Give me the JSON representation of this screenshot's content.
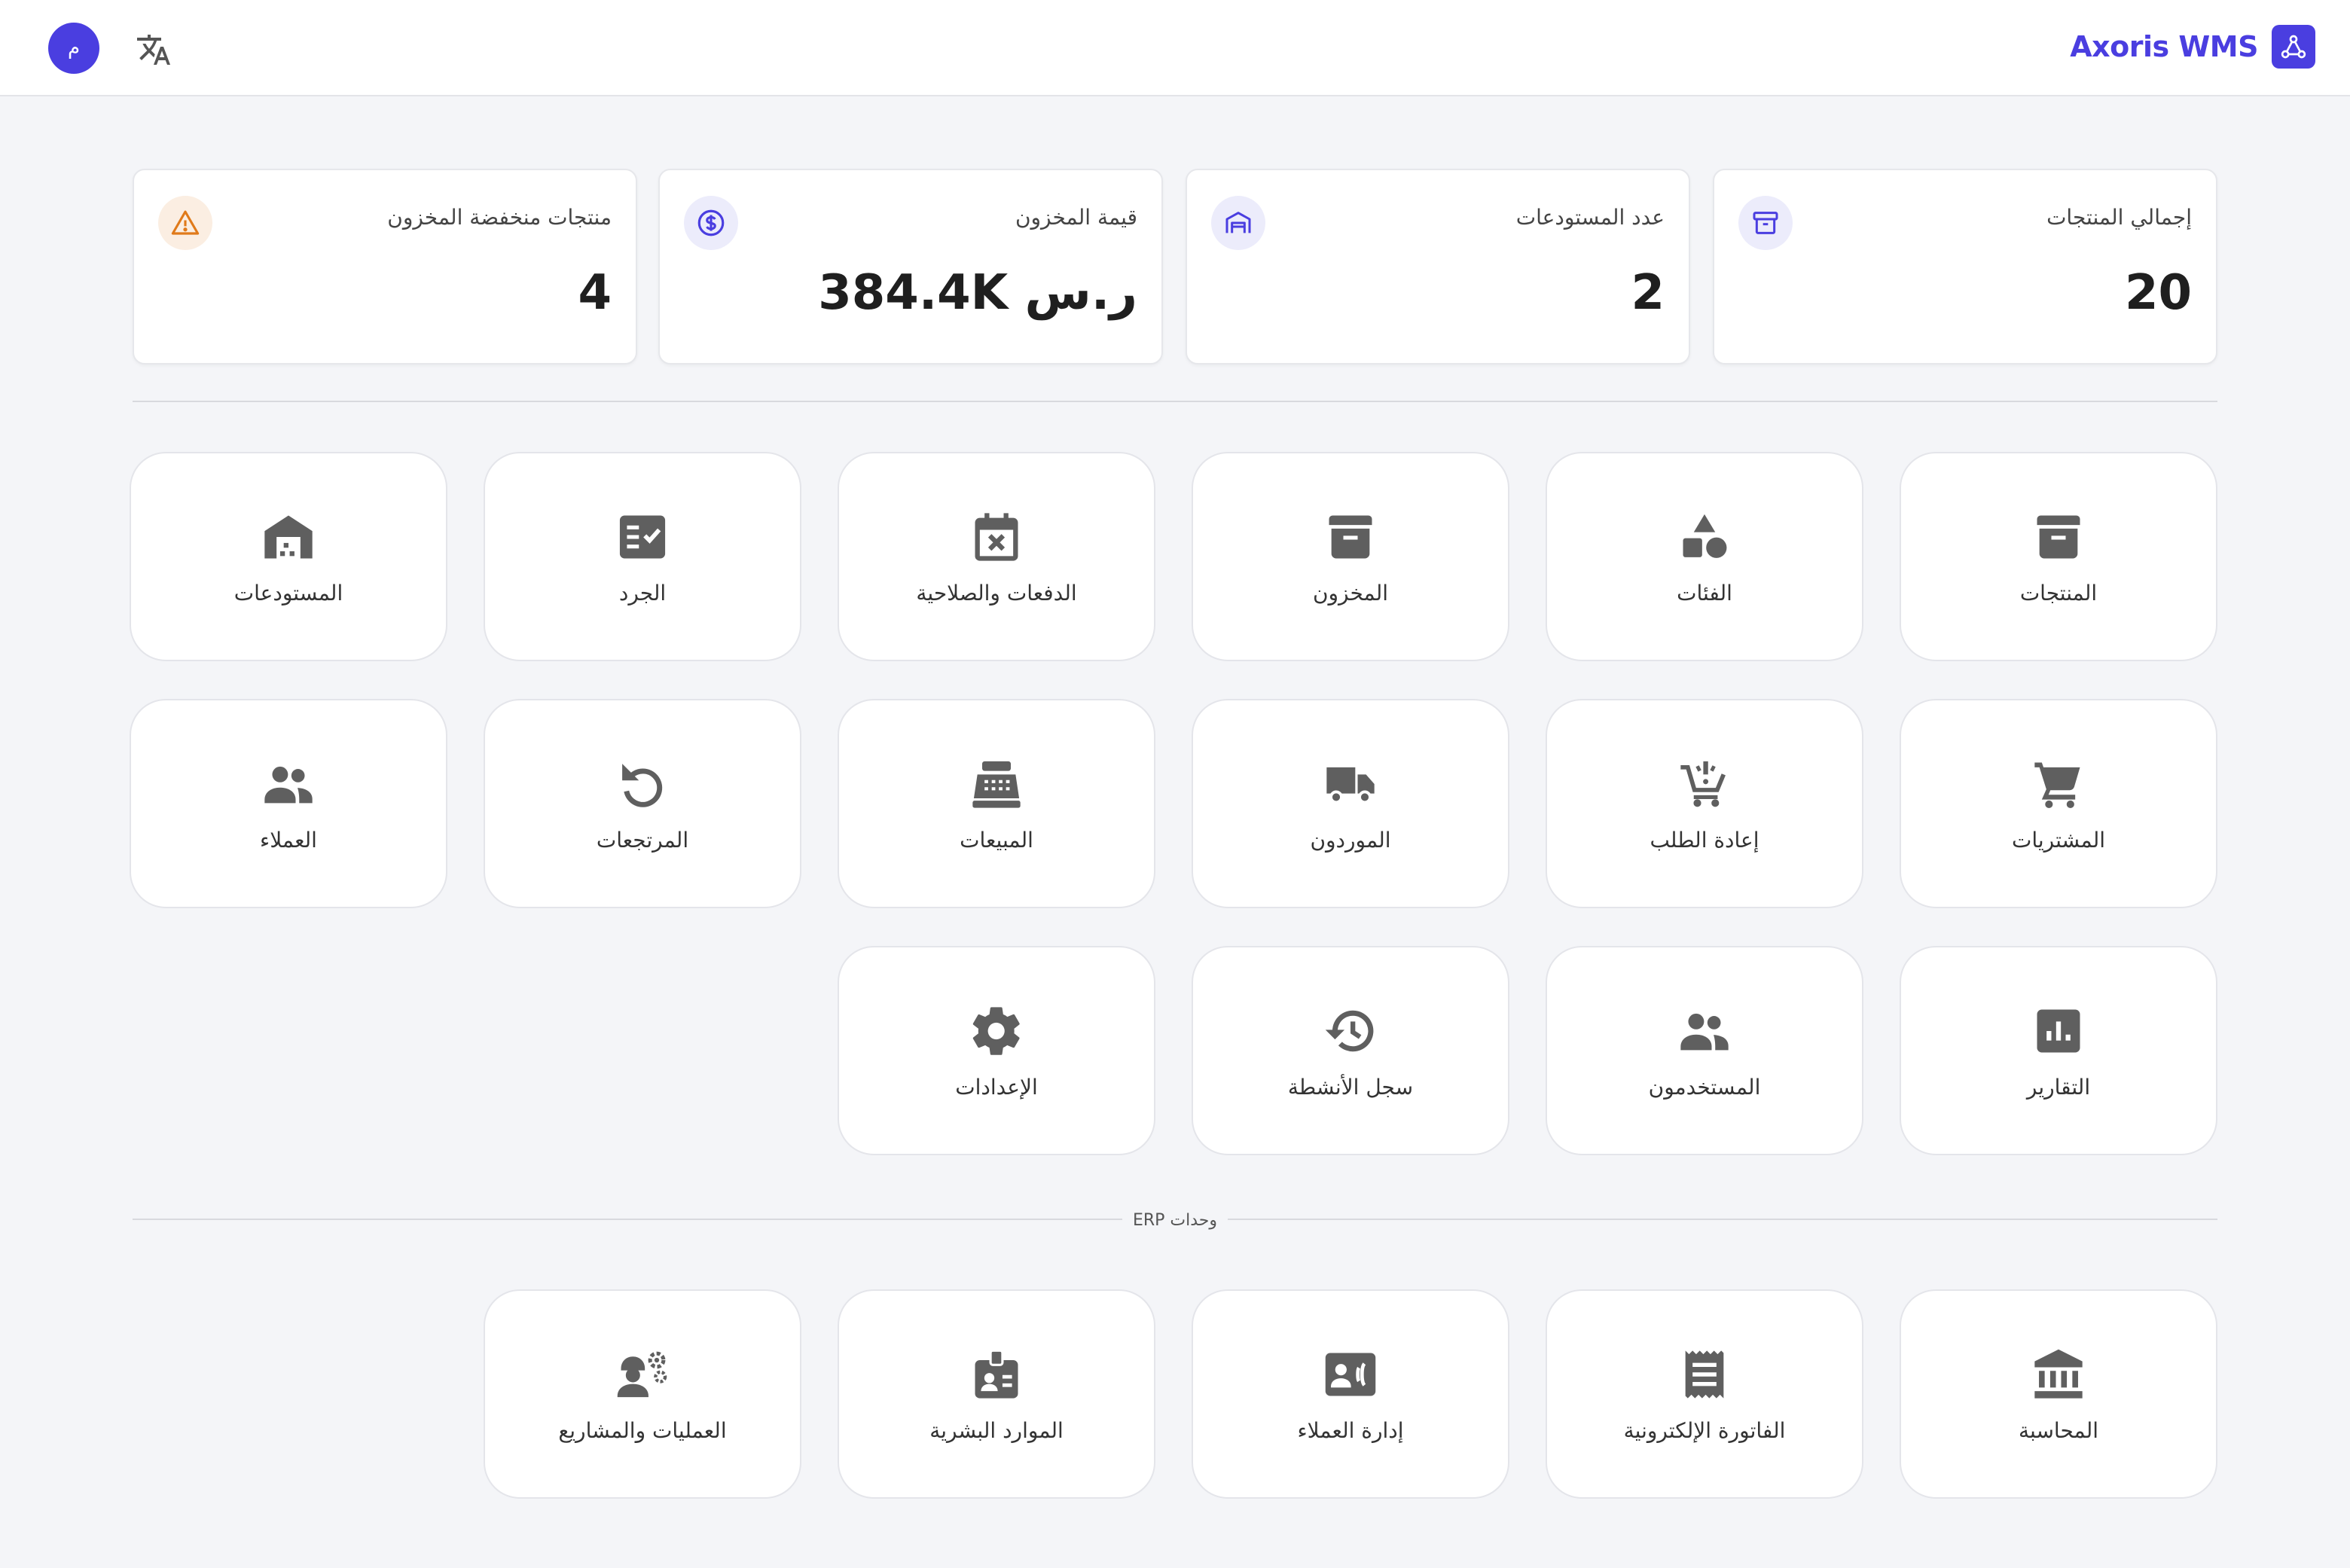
{
  "header": {
    "brand": "Axoris WMS",
    "avatar_initial": "م"
  },
  "stats": [
    {
      "label": "إجمالي المنتجات",
      "value": "20",
      "icon": "archive-icon",
      "color": "#4a3ee0"
    },
    {
      "label": "عدد المستودعات",
      "value": "2",
      "icon": "warehouse-icon",
      "color": "#4a3ee0"
    },
    {
      "label": "قيمة المخزون",
      "value": "384.4K ر.س",
      "icon": "dollar-icon",
      "color": "#4a3ee0"
    },
    {
      "label": "منتجات منخفضة المخزون",
      "value": "4",
      "icon": "warning-icon",
      "color": "#e07a1a"
    }
  ],
  "modules": [
    {
      "label": "المنتجات",
      "icon": "archive-icon"
    },
    {
      "label": "الفئات",
      "icon": "shapes-icon"
    },
    {
      "label": "المخزون",
      "icon": "inventory-icon"
    },
    {
      "label": "الدفعات والصلاحية",
      "icon": "calendar-x-icon"
    },
    {
      "label": "الجرد",
      "icon": "checklist-icon"
    },
    {
      "label": "المستودعات",
      "icon": "warehouse-icon"
    },
    {
      "label": "المشتريات",
      "icon": "cart-icon"
    },
    {
      "label": "إعادة الطلب",
      "icon": "cart-alert-icon"
    },
    {
      "label": "الموردون",
      "icon": "truck-icon"
    },
    {
      "label": "المبيعات",
      "icon": "cash-register-icon"
    },
    {
      "label": "المرتجعات",
      "icon": "return-icon"
    },
    {
      "label": "العملاء",
      "icon": "people-icon"
    },
    {
      "label": "التقارير",
      "icon": "bar-chart-icon"
    },
    {
      "label": "المستخدمون",
      "icon": "users-icon"
    },
    {
      "label": "سجل الأنشطة",
      "icon": "history-icon"
    },
    {
      "label": "الإعدادات",
      "icon": "gear-icon"
    }
  ],
  "erp": {
    "title": "وحدات ERP",
    "modules": [
      {
        "label": "المحاسبة",
        "icon": "bank-icon"
      },
      {
        "label": "الفاتورة الإلكترونية",
        "icon": "receipt-icon"
      },
      {
        "label": "إدارة العملاء",
        "icon": "contact-phone-icon"
      },
      {
        "label": "الموارد البشرية",
        "icon": "badge-icon"
      },
      {
        "label": "العمليات والمشاريع",
        "icon": "engineer-icon"
      }
    ]
  }
}
